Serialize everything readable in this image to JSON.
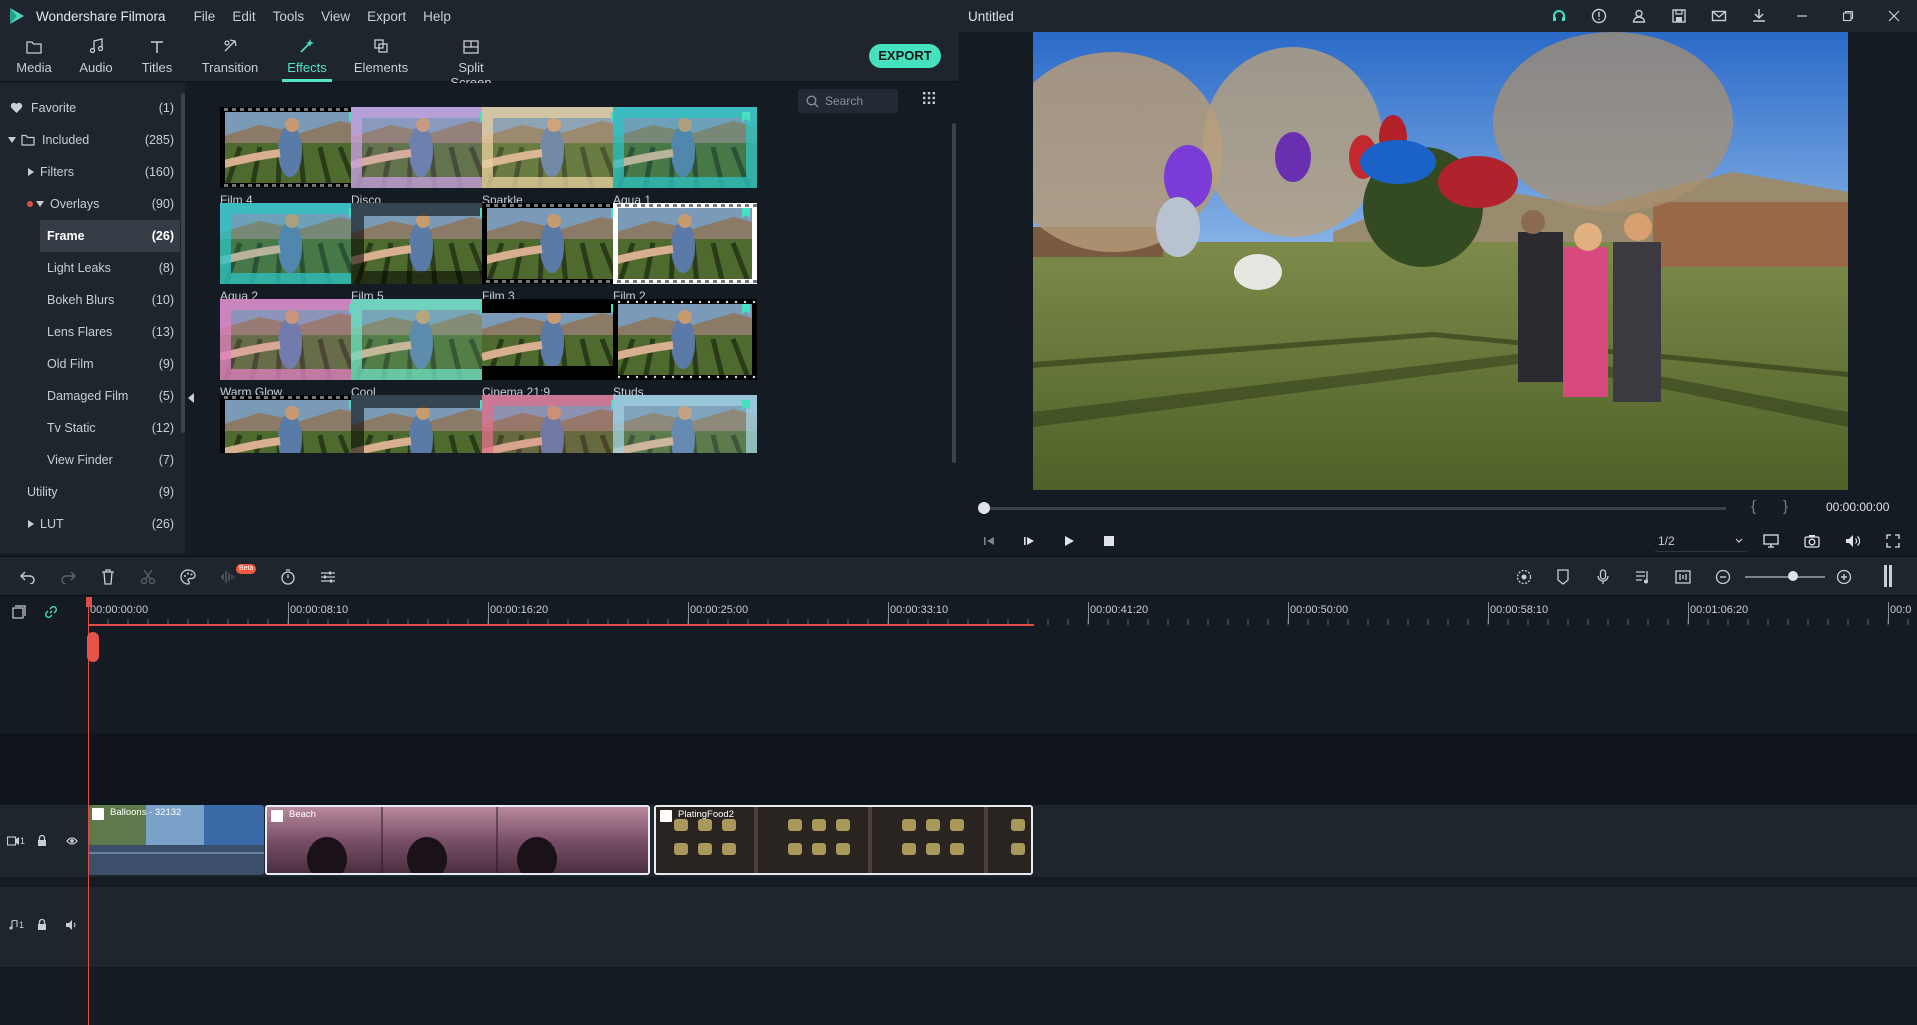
{
  "titlebar": {
    "app_name": "Wondershare Filmora",
    "menu": [
      "File",
      "Edit",
      "Tools",
      "View",
      "Export",
      "Help"
    ],
    "document_title": "Untitled",
    "icons": [
      "headset-icon",
      "info-icon",
      "account-icon",
      "save-icon",
      "mail-icon",
      "download-icon",
      "minimize-icon",
      "maximize-icon",
      "close-icon"
    ]
  },
  "toolbar": {
    "tabs": [
      {
        "label": "Media",
        "icon": "folder-icon"
      },
      {
        "label": "Audio",
        "icon": "music-note-icon"
      },
      {
        "label": "Titles",
        "icon": "text-icon"
      },
      {
        "label": "Transition",
        "icon": "transition-icon"
      },
      {
        "label": "Effects",
        "icon": "effects-icon"
      },
      {
        "label": "Elements",
        "icon": "elements-icon"
      },
      {
        "label": "Split Screen",
        "icon": "split-screen-icon"
      }
    ],
    "active_tab": "Effects",
    "export_label": "EXPORT"
  },
  "sidebar": {
    "items": [
      {
        "label": "Favorite",
        "count": "(1)"
      },
      {
        "label": "Included",
        "count": "(285)"
      },
      {
        "label": "Filters",
        "count": "(160)"
      },
      {
        "label": "Overlays",
        "count": "(90)"
      },
      {
        "label": "Frame",
        "count": "(26)"
      },
      {
        "label": "Light Leaks",
        "count": "(8)"
      },
      {
        "label": "Bokeh Blurs",
        "count": "(10)"
      },
      {
        "label": "Lens Flares",
        "count": "(13)"
      },
      {
        "label": "Old Film",
        "count": "(9)"
      },
      {
        "label": "Damaged Film",
        "count": "(5)"
      },
      {
        "label": "Tv Static",
        "count": "(12)"
      },
      {
        "label": "View Finder",
        "count": "(7)"
      },
      {
        "label": "Utility",
        "count": "(9)"
      },
      {
        "label": "LUT",
        "count": "(26)"
      }
    ],
    "selected": "Frame"
  },
  "browser": {
    "search_placeholder": "Search",
    "effects": [
      "Film 4",
      "Disco",
      "Sparkle",
      "Aqua 1",
      "Aqua 2",
      "Film 5",
      "Film 3",
      "Film 2",
      "Warm Glow",
      "Cool",
      "Cinema 21:9",
      "Studs",
      "",
      "",
      "",
      ""
    ]
  },
  "preview": {
    "timecode": "00:00:00:00",
    "ratio": "1/2",
    "brace_open": "{",
    "brace_close": "}"
  },
  "timeline": {
    "ruler_labels": [
      "00:00:00:00",
      "00:00:08:10",
      "00:00:16:20",
      "00:00:25:00",
      "00:00:33:10",
      "00:00:41:20",
      "00:00:50:00",
      "00:00:58:10",
      "00:01:06:20",
      "00:0"
    ],
    "clips": [
      {
        "name": "Balloons - 32132",
        "color": "#2a4d7a"
      },
      {
        "name": "Beach",
        "color": "#6b4257"
      },
      {
        "name": "PlatingFood2",
        "color": "#2b2520"
      }
    ],
    "video_track_label": "1",
    "audio_track_label": "1",
    "beta_label": "Beta"
  },
  "colors": {
    "accent": "#46e1bf",
    "playhead": "#e24c46",
    "panel": "#1e252d",
    "background": "#151b22"
  }
}
